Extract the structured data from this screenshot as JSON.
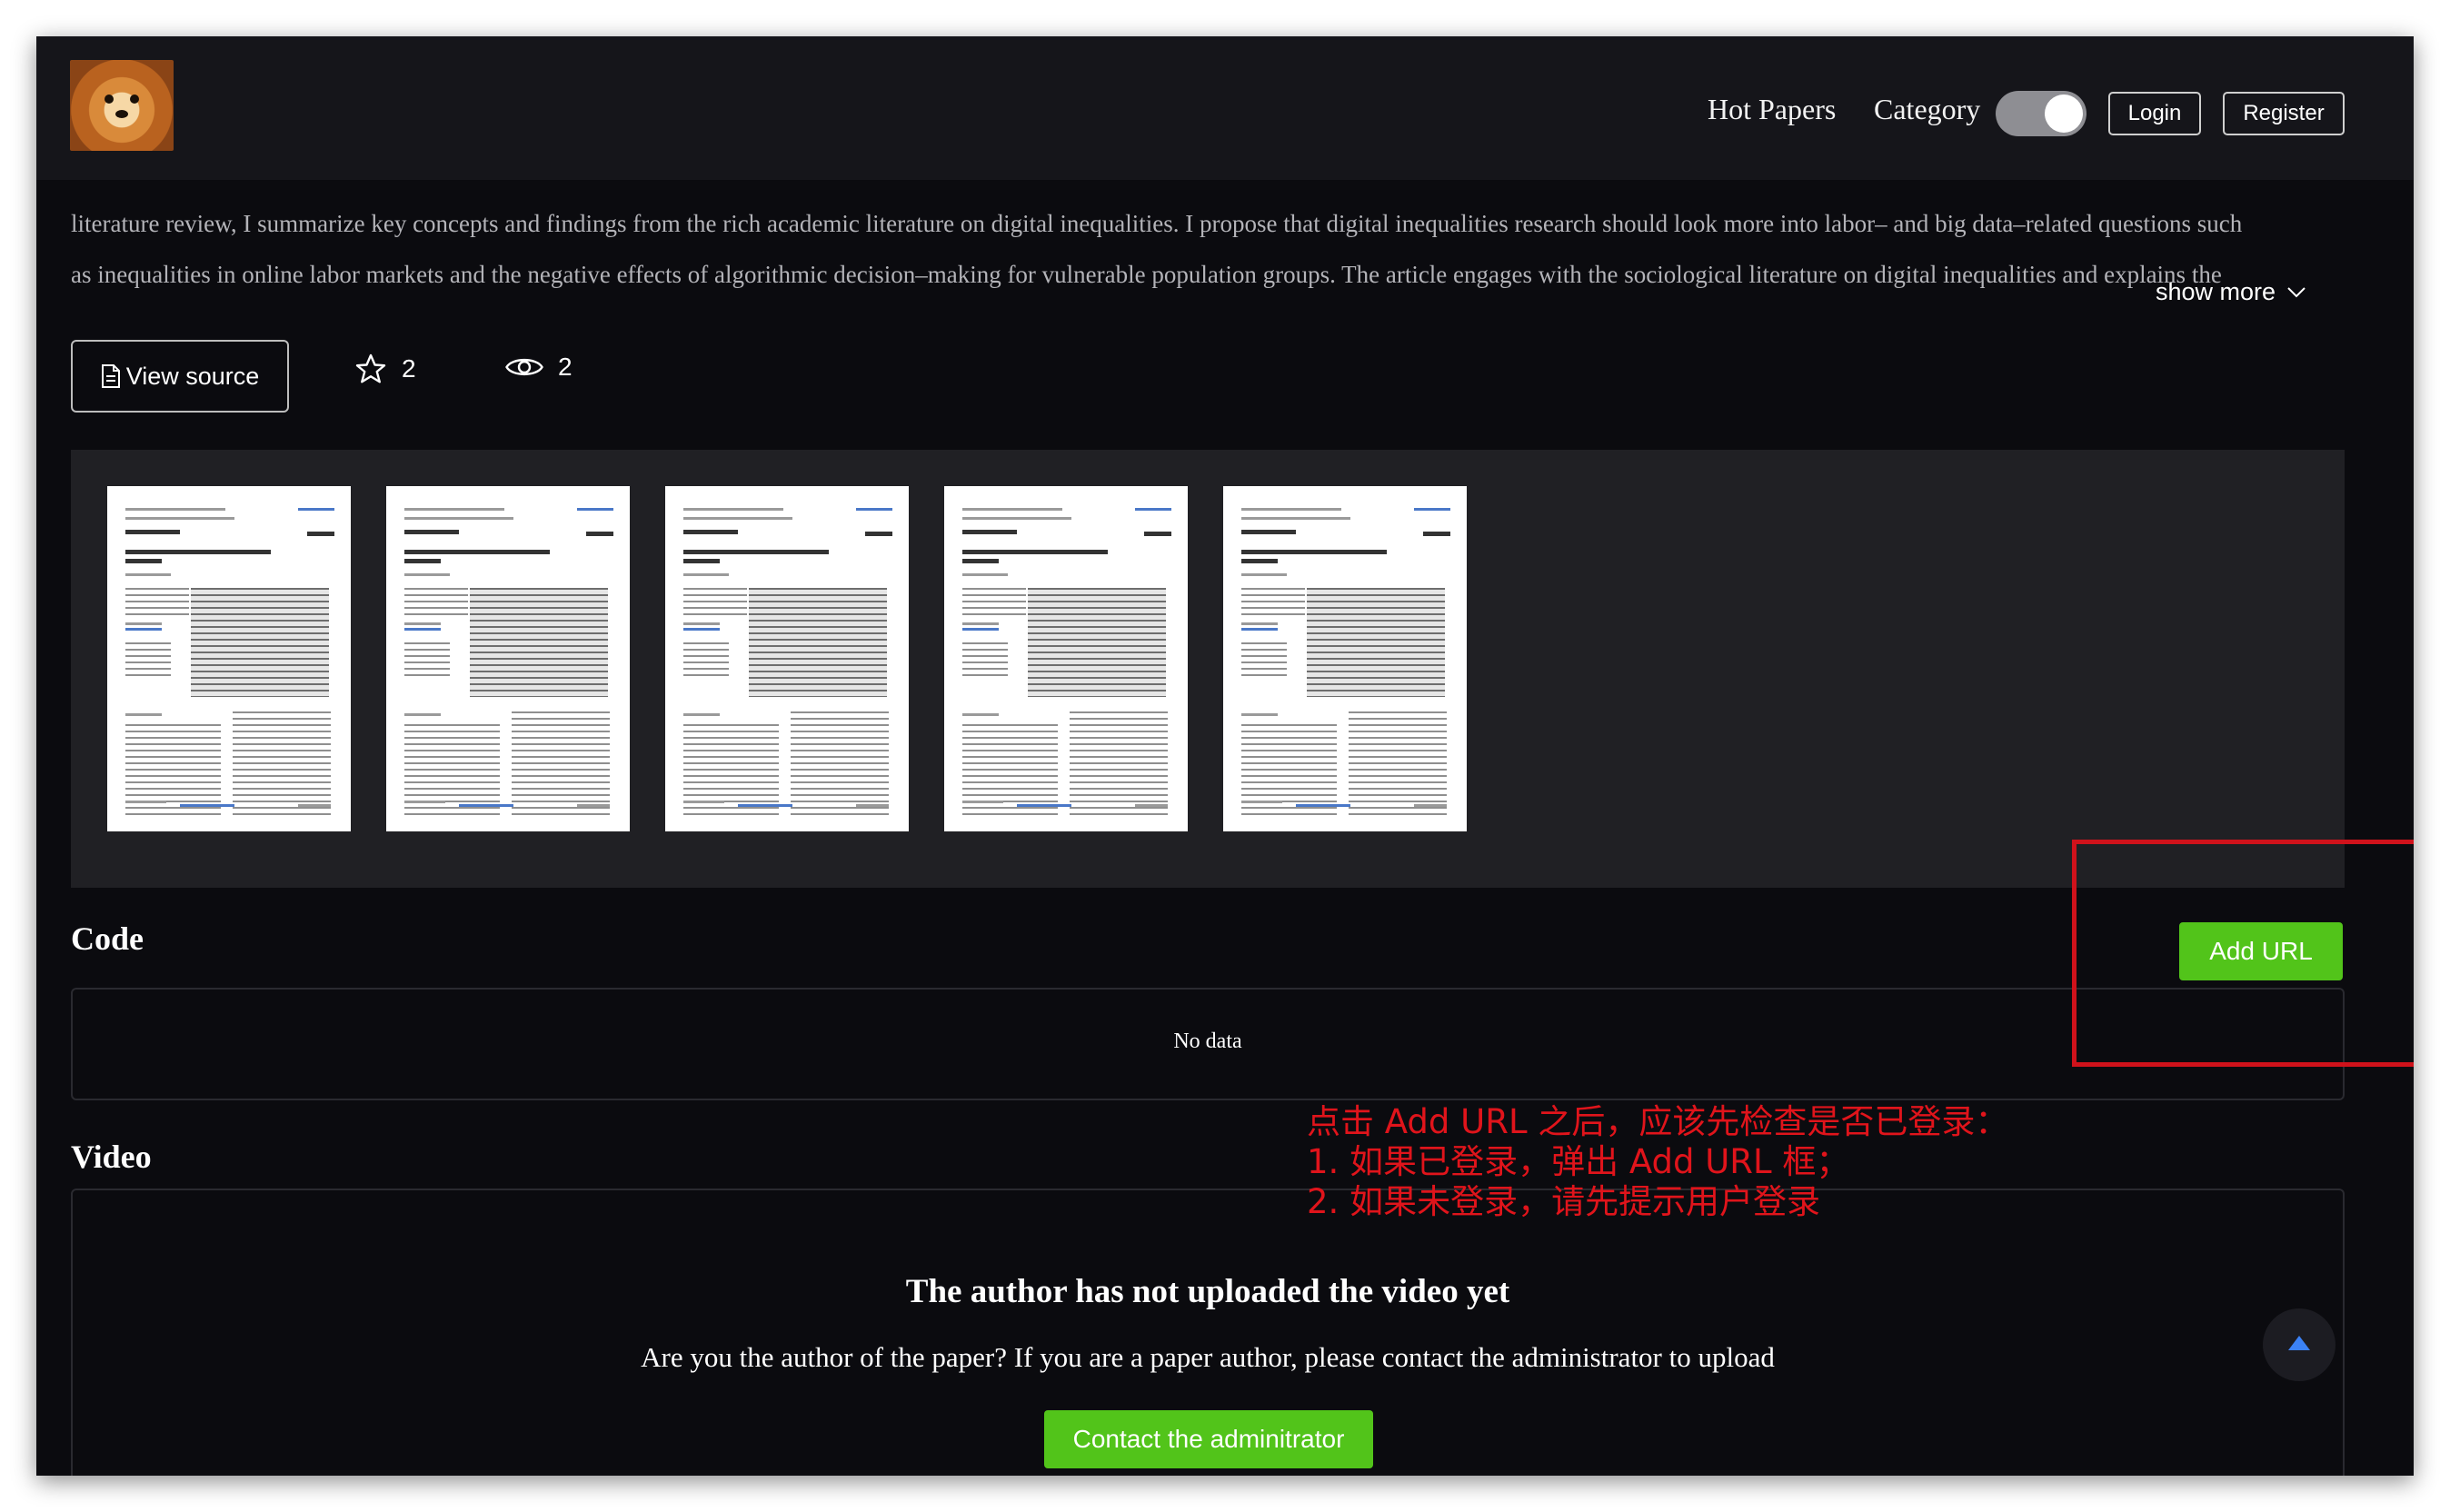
{
  "nav": {
    "hot_papers": "Hot Papers",
    "category": "Category",
    "login": "Login",
    "register": "Register",
    "logo_icon": "dog-avatar-logo"
  },
  "abstract": {
    "line1": "literature review, I summarize key concepts and findings from the rich academic literature on digital inequalities. I propose that digital inequalities research should look more into labor– and big data–related questions such",
    "line2": "as inequalities in online labor markets and the negative effects of algorithmic decision–making for vulnerable population groups. The article engages with the sociological literature on digital inequalities and explains the",
    "show_more": "show more"
  },
  "actions": {
    "view_source": "View source",
    "stars": "2",
    "views": "2"
  },
  "thumbnails": {
    "count": 5,
    "paper_title": "Digital inequalities in the age of artificial intelligence and big data"
  },
  "code": {
    "title": "Code",
    "add_url": "Add URL",
    "empty": "No data"
  },
  "video": {
    "title": "Video",
    "heading": "The author has not uploaded the video yet",
    "message": "Are you the author of the paper? If you are a paper author, please contact the administrator to upload",
    "contact_button": "Contact the adminitrator"
  },
  "annotation": {
    "line1": "点击 Add URL 之后，应该先检查是否已登录：",
    "line2": "1. 如果已登录，弹出 Add URL 框；",
    "line3": "2. 如果未登录，请先提示用户登录"
  },
  "colors": {
    "background": "#0b0b0f",
    "navbar": "#15151a",
    "accent_green": "#52c41a",
    "annotation_red": "#e0141b",
    "scroll_arrow": "#3b82f6"
  }
}
